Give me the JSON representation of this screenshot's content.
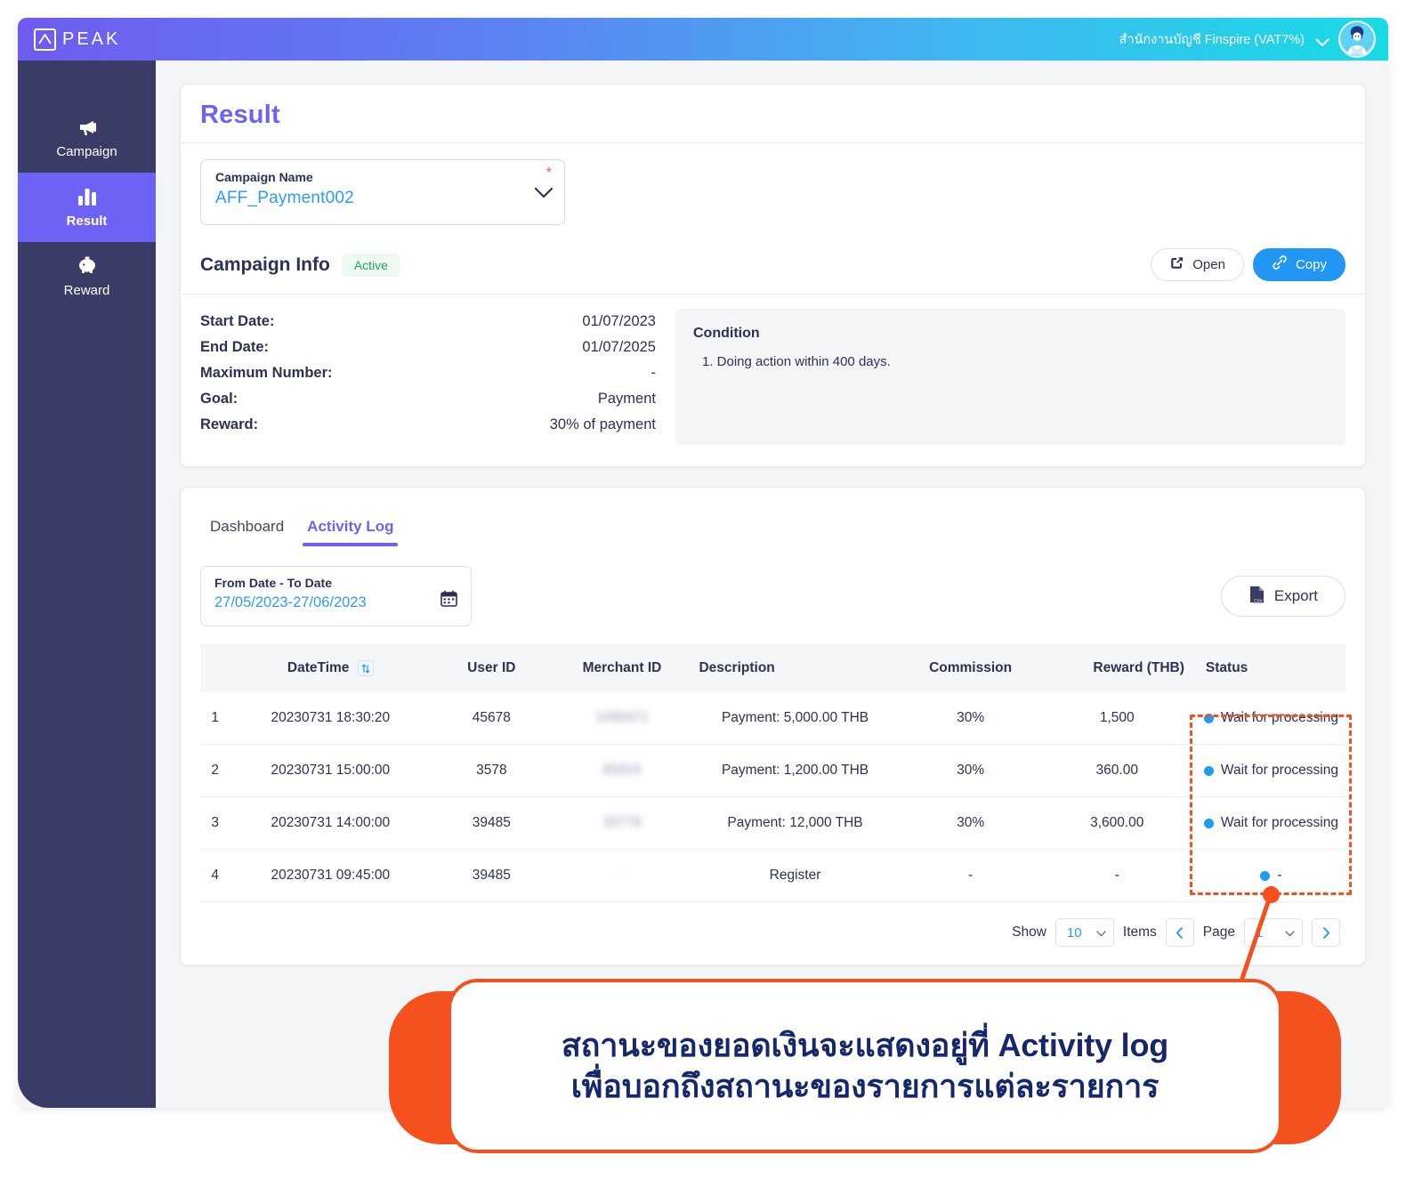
{
  "topbar": {
    "brand_text": "PEAK",
    "org_name": "สำนักงานบัญชี Finspire (VAT7%)"
  },
  "sidebar": {
    "items": [
      {
        "label": "Campaign",
        "icon": "megaphone-icon",
        "active": false
      },
      {
        "label": "Result",
        "icon": "bar-chart-icon",
        "active": true
      },
      {
        "label": "Reward",
        "icon": "piggy-bank-icon",
        "active": false
      }
    ]
  },
  "result_card": {
    "title": "Result",
    "campaign_field": {
      "label": "Campaign Name",
      "value": "AFF_Payment002",
      "required_marker": "*"
    },
    "info": {
      "heading": "Campaign Info",
      "status_badge": "Active",
      "open_label": "Open",
      "copy_label": "Copy",
      "rows": [
        {
          "key": "Start Date:",
          "value": "01/07/2023"
        },
        {
          "key": "End Date:",
          "value": "01/07/2025"
        },
        {
          "key": "Maximum Number:",
          "value": "-"
        },
        {
          "key": "Goal:",
          "value": "Payment"
        },
        {
          "key": "Reward:",
          "value": "30% of payment"
        }
      ],
      "condition_title": "Condition",
      "condition_items": [
        "1. Doing action within 400 days."
      ]
    }
  },
  "log_card": {
    "tabs": [
      {
        "label": "Dashboard",
        "active": false
      },
      {
        "label": "Activity Log",
        "active": true
      }
    ],
    "date_filter": {
      "label": "From Date - To Date",
      "value": "27/05/2023-27/06/2023"
    },
    "export_label": "Export",
    "table": {
      "columns": [
        "DateTime",
        "User ID",
        "Merchant ID",
        "Description",
        "Commission",
        "Reward (THB)",
        "Status"
      ],
      "rows": [
        {
          "index": "1",
          "datetime": "20230731 18:30:20",
          "user_id": "45678",
          "merchant_id": "1098471",
          "description": "Payment: 5,000.00 THB",
          "commission": "30%",
          "reward": "1,500",
          "status": "Wait for processing"
        },
        {
          "index": "2",
          "datetime": "20230731 15:00:00",
          "user_id": "3578",
          "merchant_id": "95824",
          "description": "Payment: 1,200.00 THB",
          "commission": "30%",
          "reward": "360.00",
          "status": "Wait for processing"
        },
        {
          "index": "3",
          "datetime": "20230731 14:00:00",
          "user_id": "39485",
          "merchant_id": "35778",
          "description": "Payment: 12,000 THB",
          "commission": "30%",
          "reward": "3,600.00",
          "status": "Wait for processing"
        },
        {
          "index": "4",
          "datetime": "20230731 09:45:00",
          "user_id": "39485",
          "merchant_id": "-",
          "description": "Register",
          "commission": "-",
          "reward": "-",
          "status": "-"
        }
      ]
    },
    "pager": {
      "show_label": "Show",
      "page_size": "10",
      "items_label": "Items",
      "page_label": "Page",
      "page_number": "1"
    }
  },
  "annotation": {
    "line1": "สถานะของยอดเงินจะแสดงอยู่ที่ Activity log",
    "line2": "เพื่อบอกถึงสถานะของรายการแต่ละรายการ"
  },
  "colors": {
    "accent_purple": "#6c63f5",
    "accent_blue": "#2196f3",
    "status_dot": "#1f9cf0",
    "annotation_orange": "#f4511e",
    "sidebar_bg": "#3b3b68",
    "active_green": "#22a463"
  }
}
